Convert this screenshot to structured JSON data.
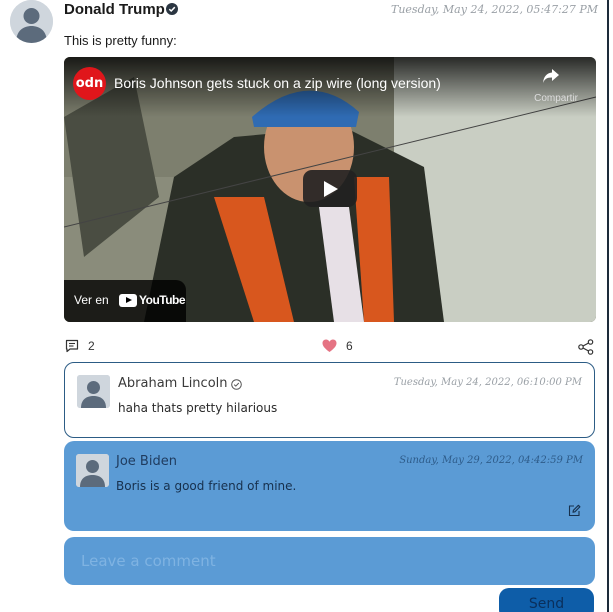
{
  "post": {
    "author": "Donald Trump",
    "date": "Tuesday, May 24, 2022, 05:47:27 PM",
    "text": "This is pretty funny:",
    "comments_count": "2",
    "likes_count": "6",
    "icons": {
      "verified": "verified-badge-icon",
      "comments": "comment-icon",
      "like": "heart-icon",
      "share": "share-icon"
    }
  },
  "video": {
    "channel_logo": "odn",
    "title": "Boris Johnson gets stuck on a zip wire (long version)",
    "share_label": "Compartir",
    "watch_label": "Ver en",
    "youtube_label": "YouTube"
  },
  "comments": [
    {
      "author": "Abraham Lincoln",
      "date": "Tuesday, May 24, 2022, 06:10:00 PM",
      "text": "haha thats pretty hilarious"
    },
    {
      "author": "Joe Biden",
      "date": "Sunday, May 29, 2022, 04:42:59 PM",
      "text": "Boris is a good friend of mine."
    }
  ],
  "comment_form": {
    "placeholder": "Leave a comment",
    "send_label": "Send"
  },
  "colors": {
    "accent": "#5b9bd5",
    "send_button": "#0e5da8",
    "like": "#e57383",
    "border": "#2c5c85"
  }
}
